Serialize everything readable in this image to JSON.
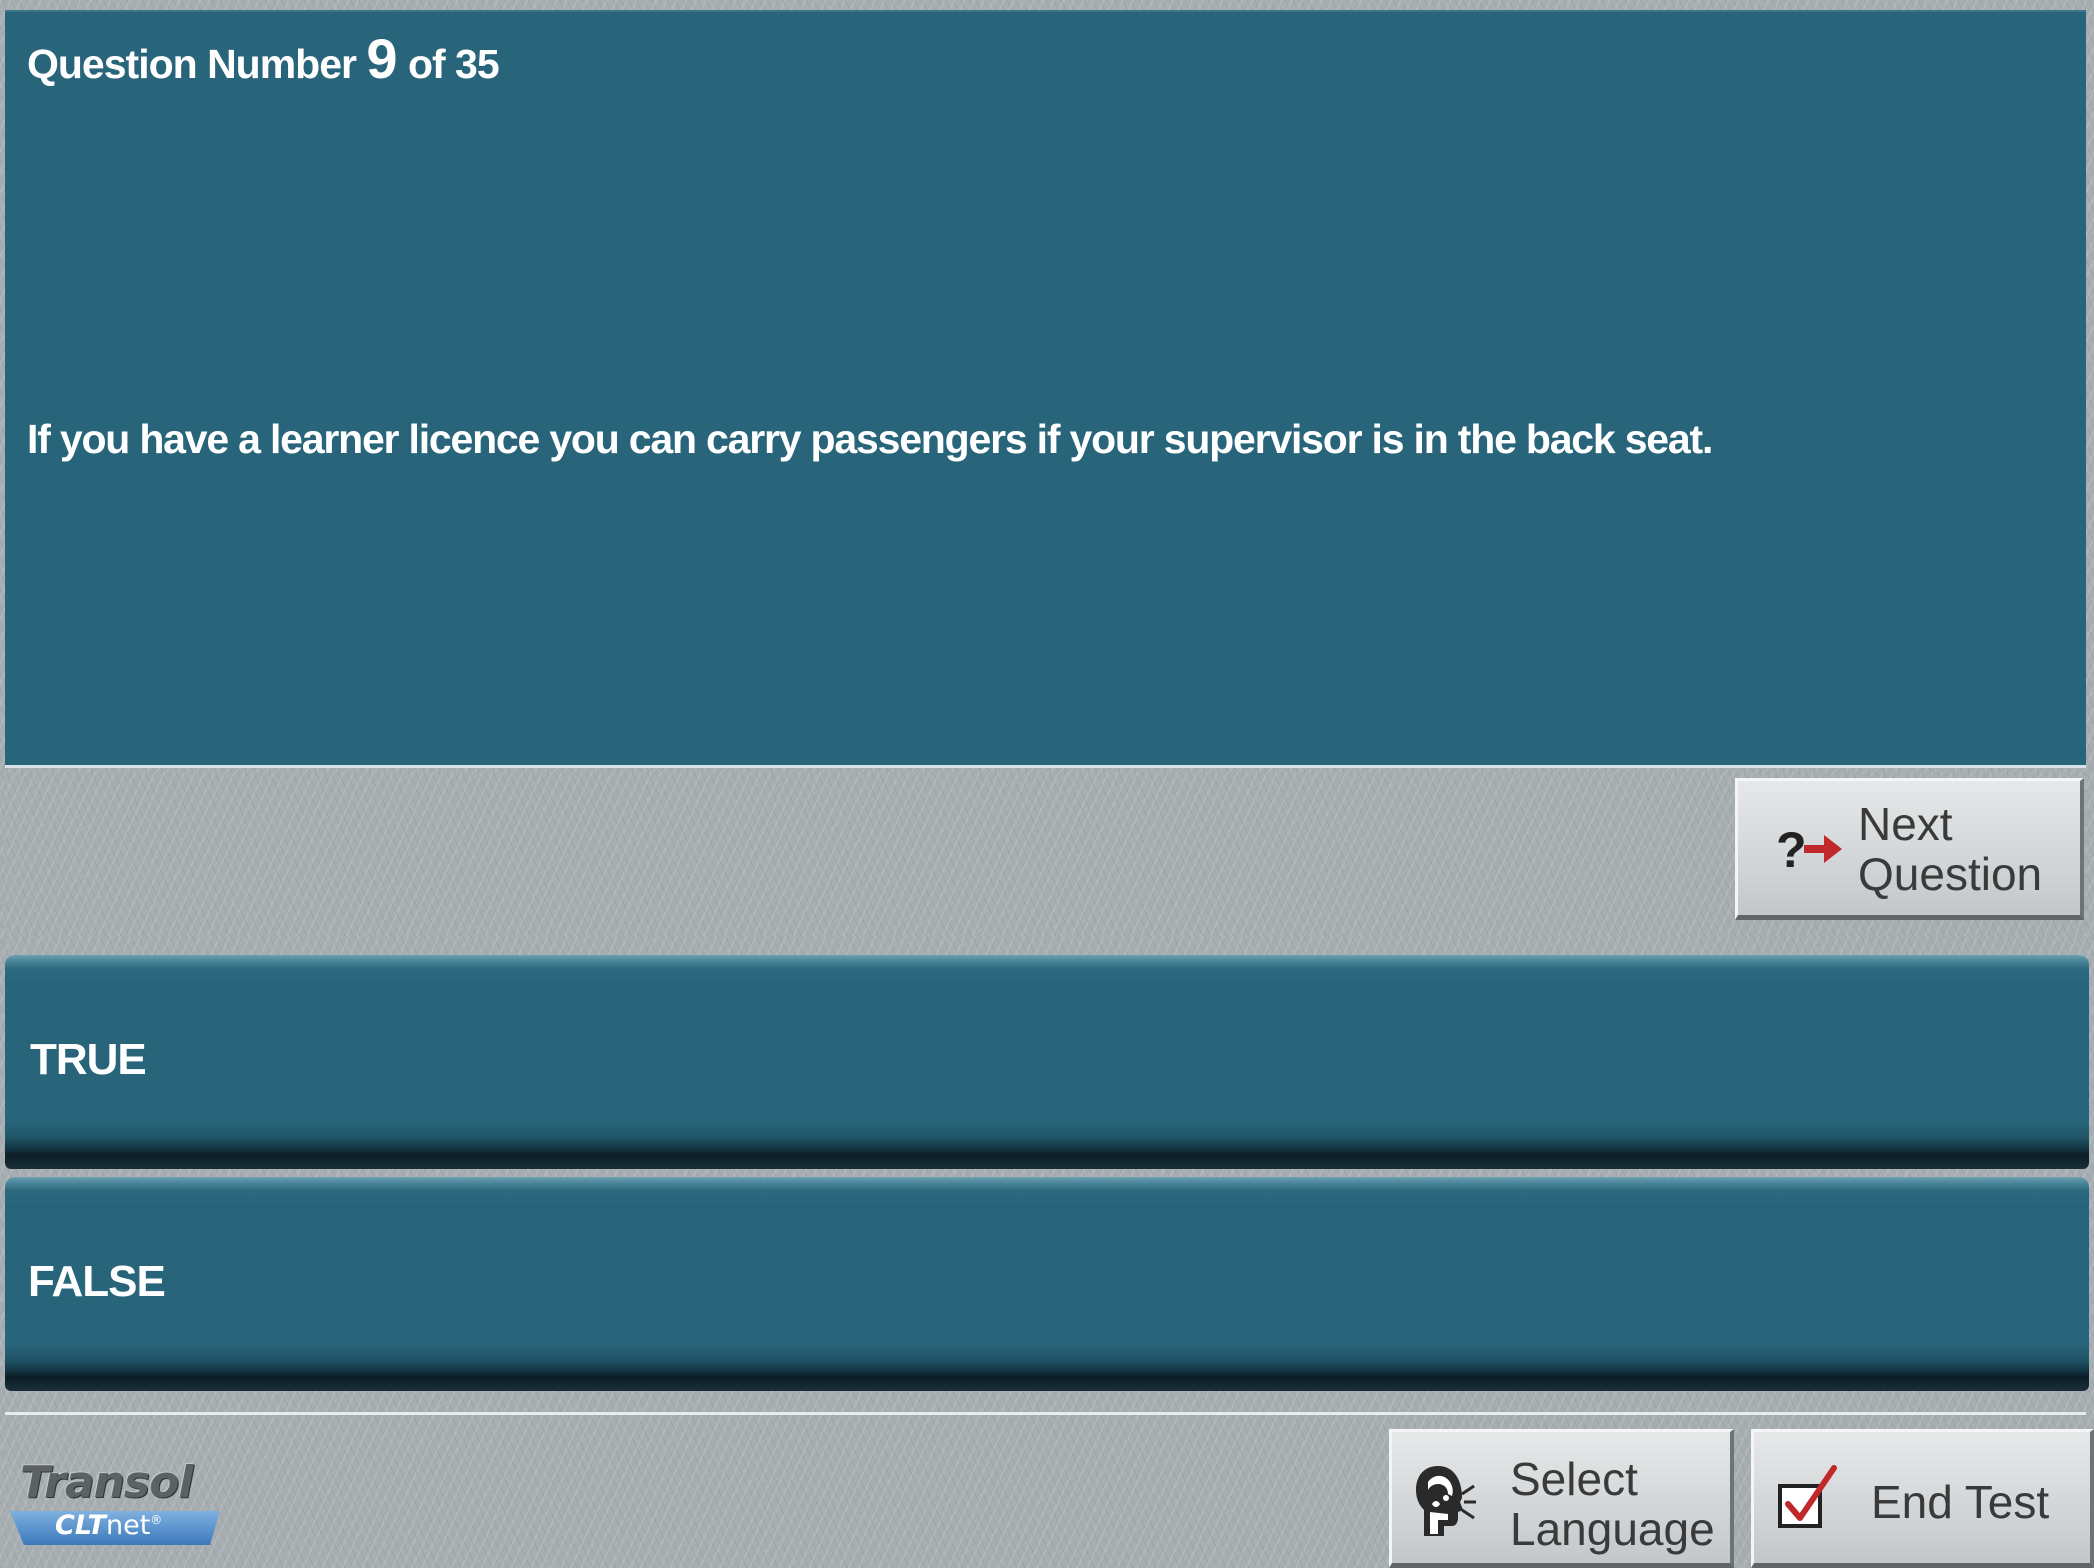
{
  "question": {
    "prefix": "Question Number",
    "number": "9",
    "of_label": "of 35",
    "text": "If you have a learner licence you can carry passengers if your supervisor is in the back seat."
  },
  "answers": [
    {
      "label": "TRUE"
    },
    {
      "label": "FALSE"
    }
  ],
  "buttons": {
    "next_line1": "Next",
    "next_line2": "Question",
    "language_line1": "Select",
    "language_line2": "Language",
    "end_test": "End Test"
  },
  "icons": {
    "next": "question-arrow-icon",
    "language": "speaking-head-icon",
    "end_test": "checkbox-tick-icon"
  },
  "logo": {
    "brand": "Transol",
    "product_bold": "CLT",
    "product_light": "net",
    "mark": "®"
  },
  "colors": {
    "panel_teal": "#28647a",
    "background_gray": "#a7aeb1",
    "button_gray": "#d4d7d9",
    "arrow_red": "#c0282a",
    "logo_blue": "#4f8fd0"
  }
}
